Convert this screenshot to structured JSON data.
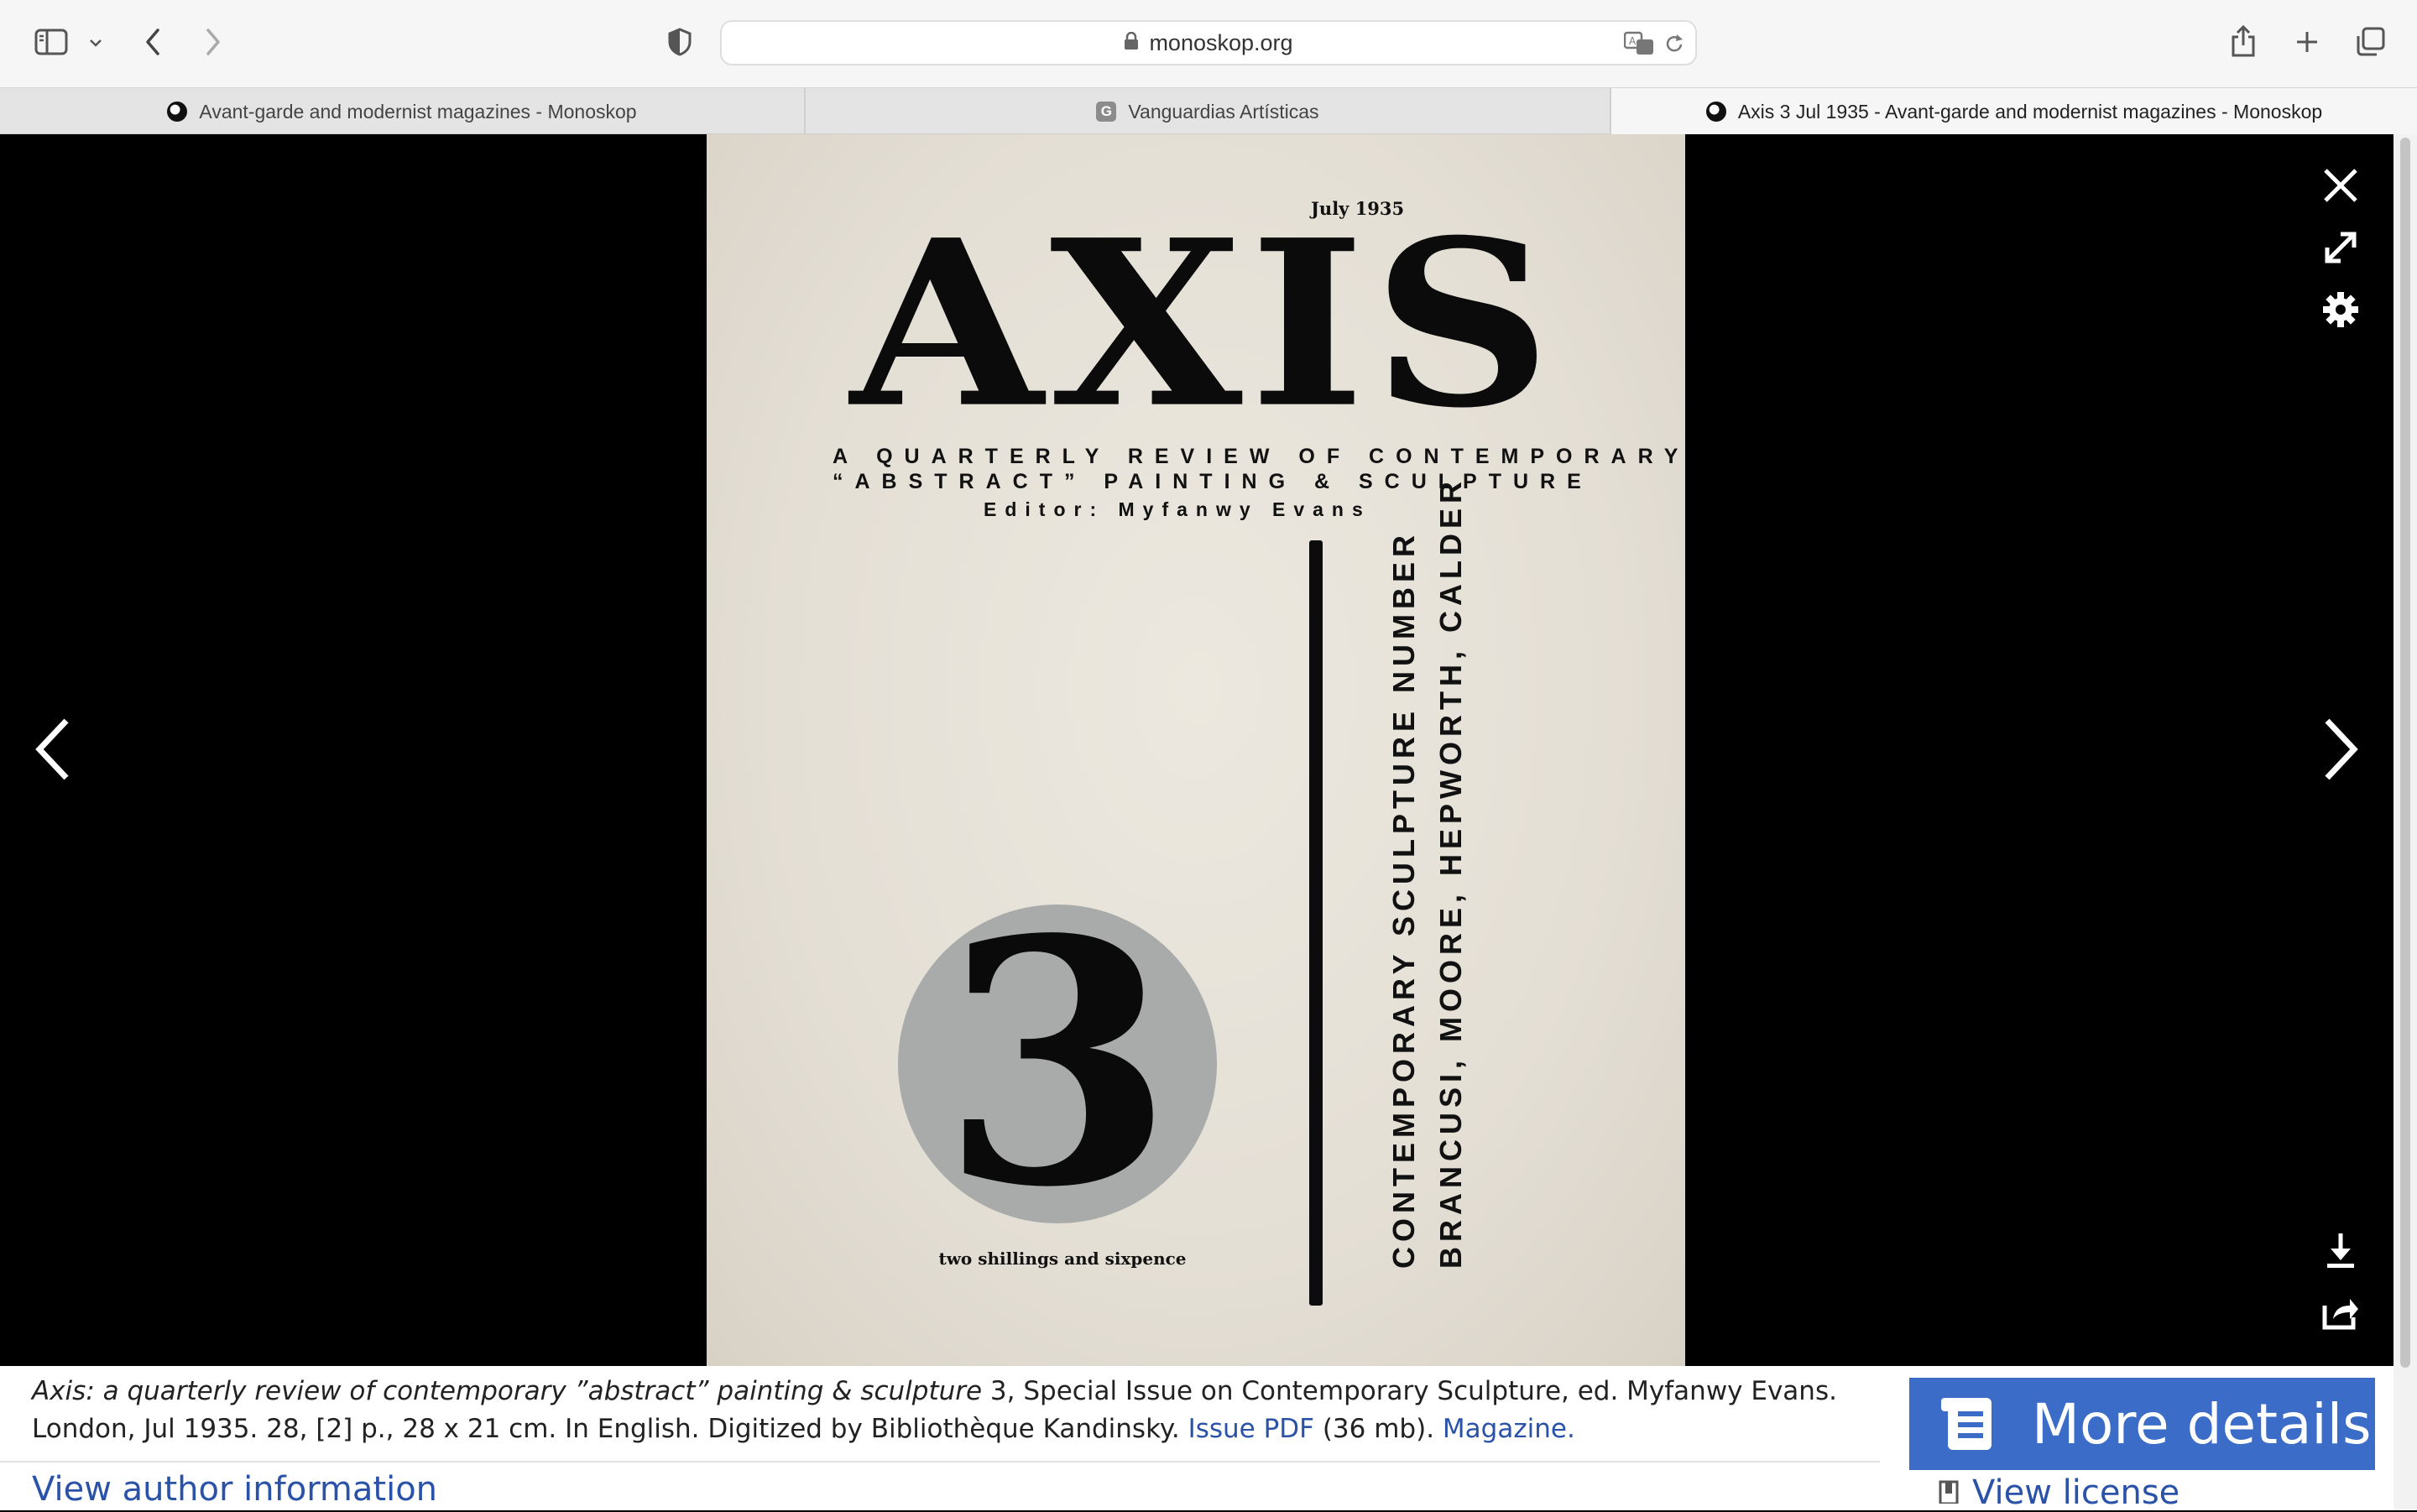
{
  "browser": {
    "url": "monoskop.org",
    "tabs": [
      {
        "title": "Avant-garde and modernist magazines - Monoskop",
        "icon": "monoskop-favicon",
        "active": false
      },
      {
        "title": "Vanguardias Artísticas",
        "icon": "g-favicon",
        "favicon_letter": "G",
        "active": false
      },
      {
        "title": "Axis 3 Jul 1935 - Avant-garde and modernist magazines - Monoskop",
        "icon": "monoskop-favicon",
        "active": true
      }
    ],
    "toolbar_icons": [
      "sidebar-icon",
      "chevron-down-icon",
      "back-icon",
      "forward-icon",
      "shield-icon",
      "translate-icon",
      "reload-icon",
      "share-icon",
      "new-tab-icon",
      "tab-overview-icon"
    ]
  },
  "cover": {
    "date": "July 1935",
    "title": "AXIS",
    "subtitle_line1": "A QUARTERLY REVIEW OF CONTEMPORARY",
    "subtitle_line2": "“ABSTRACT” PAINTING & SCULPTURE",
    "editor": "Editor: Myfanwy Evans",
    "issue_number": "3",
    "vertical_line1": "CONTEMPORARY SCULPTURE NUMBER",
    "vertical_line2": "BRANCUSI, MOORE, HEPWORTH, CALDER",
    "price": "two shillings and sixpence"
  },
  "lightbox": {
    "controls": [
      "close-icon",
      "fullscreen-icon",
      "settings-icon",
      "prev-arrow-icon",
      "next-arrow-icon",
      "download-icon",
      "share-icon"
    ]
  },
  "caption": {
    "title_italic": "Axis: a quarterly review of contemporary ”abstract” painting & sculpture",
    "text_after_title": " 3, Special Issue on Contemporary Sculpture, ed. Myfanwy Evans. London, Jul 1935. 28, [2] p., 28 x 21 cm. In English. Digitized by Bibliothèque Kandinsky. ",
    "issue_pdf_link": "Issue PDF",
    "pdf_size": " (36 mb). ",
    "magazine_link": "Magazine.",
    "more_details_label": "More details",
    "view_author_label": "View author information",
    "view_license_label": "View license"
  },
  "colors": {
    "link": "#2a52a8",
    "button": "#3a6cc8",
    "viewer_bg": "#000000",
    "cover_paper": "#e6e2d9",
    "disk_gray": "#a8abaa"
  }
}
